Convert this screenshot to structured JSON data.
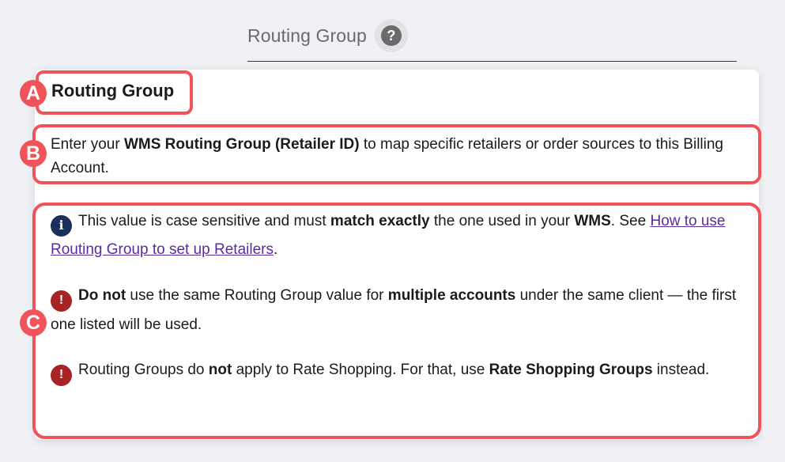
{
  "field": {
    "label": "Routing Group",
    "help_glyph": "?"
  },
  "tooltip": {
    "title": "Routing Group",
    "desc": {
      "p1": "Enter your ",
      "b1": "WMS Routing Group (Retailer ID)",
      "p2": " to map specific retailers or order sources to this Billing Account."
    },
    "note1": {
      "icon": "info-icon",
      "p1": "This value is case sensitive and must ",
      "b1": "match exactly",
      "p2": " the one used in your ",
      "b2": "WMS",
      "p3": ". See ",
      "link": "How to use Routing Group to set up Retailers",
      "p4": "."
    },
    "note2": {
      "icon": "warning-icon",
      "b1": "Do not",
      "p1": " use the same Routing Group value for ",
      "b2": "multiple accounts",
      "p2": " under the same client — the first one listed will be used."
    },
    "note3": {
      "icon": "warning-icon",
      "p1": "Routing Groups do ",
      "b1": "not",
      "p2": " apply to Rate Shopping. For that, use ",
      "b2": "Rate Shopping Groups",
      "p3": " instead."
    }
  },
  "markers": {
    "a": "A",
    "b": "B",
    "c": "C"
  },
  "colors": {
    "highlight": "#f0545a",
    "info_icon": "#1b2f5b",
    "warning_icon": "#a82424",
    "link": "#5c2b9e"
  }
}
